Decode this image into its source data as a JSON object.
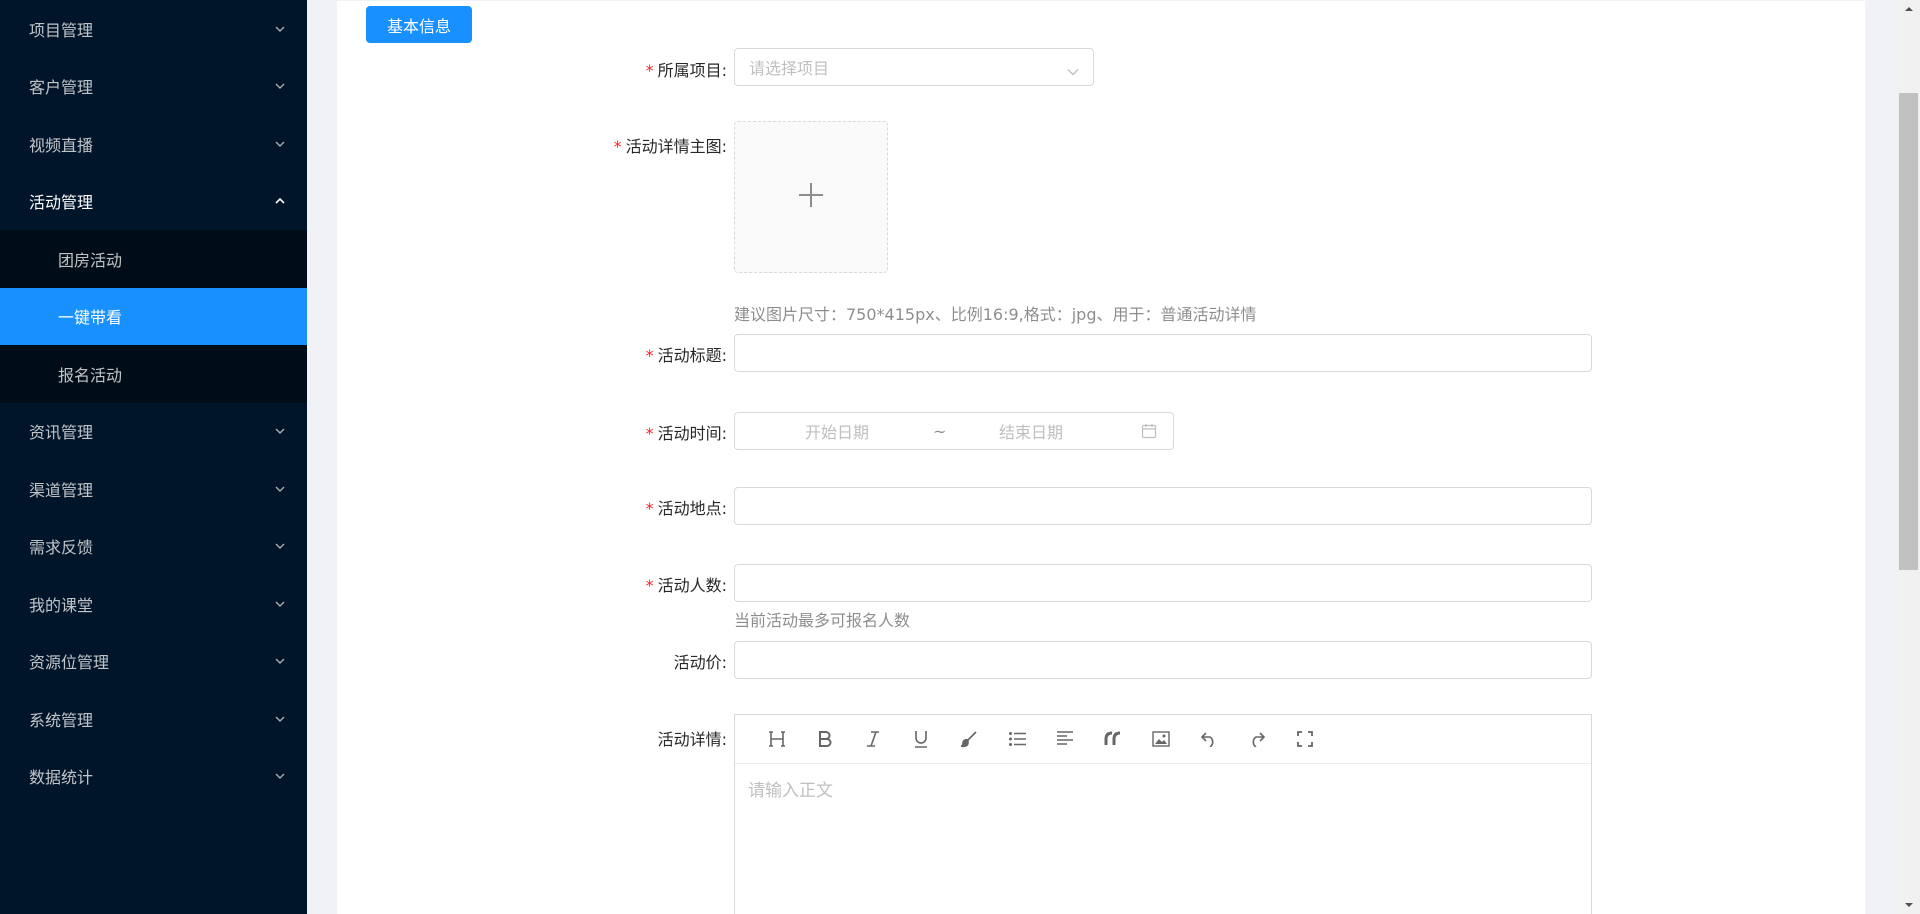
{
  "sidebar": {
    "items": [
      {
        "label": "项目管理"
      },
      {
        "label": "客户管理"
      },
      {
        "label": "视频直播"
      },
      {
        "label": "活动管理"
      },
      {
        "label": "资讯管理"
      },
      {
        "label": "渠道管理"
      },
      {
        "label": "需求反馈"
      },
      {
        "label": "我的课堂"
      },
      {
        "label": "资源位管理"
      },
      {
        "label": "系统管理"
      },
      {
        "label": "数据统计"
      }
    ],
    "sub_items": [
      {
        "label": "团房活动"
      },
      {
        "label": "一键带看"
      },
      {
        "label": "报名活动"
      }
    ],
    "selected_color": "#1890ff"
  },
  "tab": {
    "label": "基本信息"
  },
  "form": {
    "project": {
      "label": "所属项目:",
      "placeholder": "请选择项目"
    },
    "main_image": {
      "label": "活动详情主图:",
      "hint": "建议图片尺寸：750*415px、比例16:9,格式：jpg、用于：普通活动详情"
    },
    "title": {
      "label": "活动标题:"
    },
    "time": {
      "label": "活动时间:",
      "start_placeholder": "开始日期",
      "separator": "~",
      "end_placeholder": "结束日期"
    },
    "location": {
      "label": "活动地点:"
    },
    "count": {
      "label": "活动人数:",
      "hint": "当前活动最多可报名人数"
    },
    "price": {
      "label": "活动价:"
    },
    "detail": {
      "label": "活动详情:",
      "placeholder": "请输入正文"
    },
    "required_mark": "*"
  },
  "toolbar_icons": [
    "heading-icon",
    "bold-icon",
    "italic-icon",
    "underline-icon",
    "brush-icon",
    "list-icon",
    "align-icon",
    "quote-icon",
    "image-icon",
    "undo-icon",
    "redo-icon",
    "fullscreen-icon"
  ]
}
